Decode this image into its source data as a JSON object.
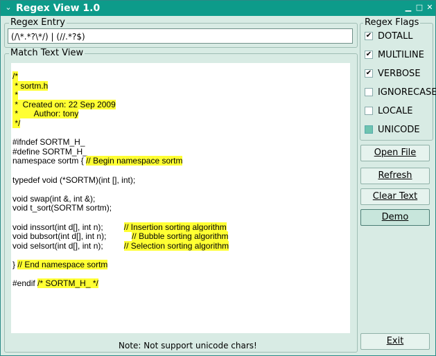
{
  "window": {
    "title": "Regex View 1.0"
  },
  "regex_entry": {
    "label": "Regex Entry",
    "value": "(/\\*.*?\\*/) | (//.*?$)"
  },
  "match_view": {
    "label": "Match Text View",
    "lines": [
      {
        "parts": [
          {
            "t": "/*",
            "h": true
          }
        ]
      },
      {
        "parts": [
          {
            "t": " * sortm.h",
            "h": true
          }
        ]
      },
      {
        "parts": [
          {
            "t": " *",
            "h": true
          }
        ]
      },
      {
        "parts": [
          {
            "t": " *  Created on: 22 Sep 2009",
            "h": true
          }
        ]
      },
      {
        "parts": [
          {
            "t": " *       Author: tony",
            "h": true
          }
        ]
      },
      {
        "parts": [
          {
            "t": " */",
            "h": true
          }
        ]
      },
      {
        "parts": []
      },
      {
        "parts": [
          {
            "t": "#ifndef SORTM_H_",
            "h": false
          }
        ]
      },
      {
        "parts": [
          {
            "t": "#define SORTM_H_",
            "h": false
          }
        ]
      },
      {
        "parts": [
          {
            "t": "namespace sortm { ",
            "h": false
          },
          {
            "t": "// Begin namespace sortm",
            "h": true
          }
        ]
      },
      {
        "parts": []
      },
      {
        "parts": [
          {
            "t": "typedef void (*SORTM)(int [], int);",
            "h": false
          }
        ]
      },
      {
        "parts": []
      },
      {
        "parts": [
          {
            "t": "void swap(int &, int &);",
            "h": false
          }
        ]
      },
      {
        "parts": [
          {
            "t": "void t_sort(SORTM sortm);",
            "h": false
          }
        ]
      },
      {
        "parts": []
      },
      {
        "parts": [
          {
            "t": "void inssort(int d[], int n);         ",
            "h": false
          },
          {
            "t": "// Insertion sorting algorithm",
            "h": true
          }
        ]
      },
      {
        "parts": [
          {
            "t": "void bubsort(int d[], int n);           ",
            "h": false
          },
          {
            "t": "// Bubble sorting algorithm",
            "h": true
          }
        ]
      },
      {
        "parts": [
          {
            "t": "void selsort(int d[], int n);         ",
            "h": false
          },
          {
            "t": "// Selection sorting algorithm",
            "h": true
          }
        ]
      },
      {
        "parts": []
      },
      {
        "parts": [
          {
            "t": "} ",
            "h": false
          },
          {
            "t": "// End namespace sortm",
            "h": true
          }
        ]
      },
      {
        "parts": []
      },
      {
        "parts": [
          {
            "t": "#endif ",
            "h": false
          },
          {
            "t": "/* SORTM_H_ */",
            "h": true
          }
        ]
      }
    ]
  },
  "note": "Note: Not support unicode chars!",
  "flags": {
    "label": "Regex Flags",
    "items": [
      {
        "label": "DOTALL",
        "state": "checked"
      },
      {
        "label": "MULTILINE",
        "state": "checked"
      },
      {
        "label": "VERBOSE",
        "state": "checked"
      },
      {
        "label": "IGNORECASE",
        "state": "unchecked"
      },
      {
        "label": "LOCALE",
        "state": "unchecked"
      },
      {
        "label": "UNICODE",
        "state": "filled"
      }
    ]
  },
  "buttons": {
    "open_file": "Open File",
    "refresh": "Refresh",
    "clear_text": "Clear Text",
    "demo": "Demo",
    "exit": "Exit"
  }
}
